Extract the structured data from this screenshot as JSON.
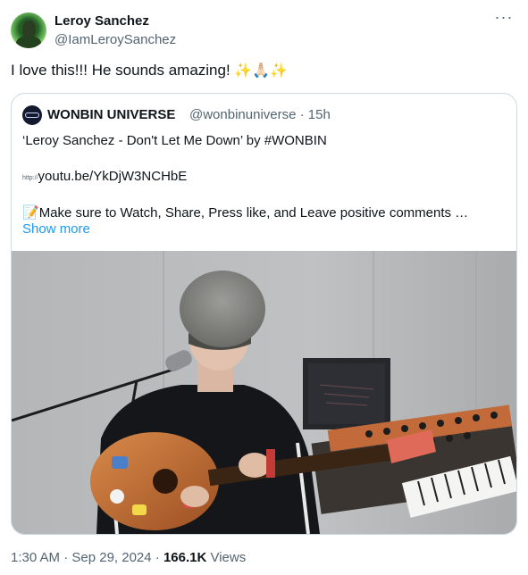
{
  "author": {
    "name": "Leroy Sanchez",
    "handle": "@IamLeroySanchez",
    "more_icon": "more-horizontal-icon"
  },
  "tweet": {
    "text": "I love this!!! He sounds amazing!",
    "emojis": "✨🙏🏻✨"
  },
  "quote": {
    "name": "WONBIN UNIVERSE",
    "handle": "@wonbinuniverse",
    "time": "· 15h",
    "line1": "‘Leroy Sanchez - Don't Let Me Down’ by #WONBIN",
    "link_prefix": "http://",
    "link": "youtu.be/YkDjW3NCHbE",
    "memo_emoji": "📝",
    "line3": "Make sure to Watch, Share, Press like, and Leave positive comments …",
    "show_more": "Show more"
  },
  "meta": {
    "time": "1:30 AM · Sep 29, 2024 · ",
    "views_count": "166.1K",
    "views_label": " Views"
  }
}
